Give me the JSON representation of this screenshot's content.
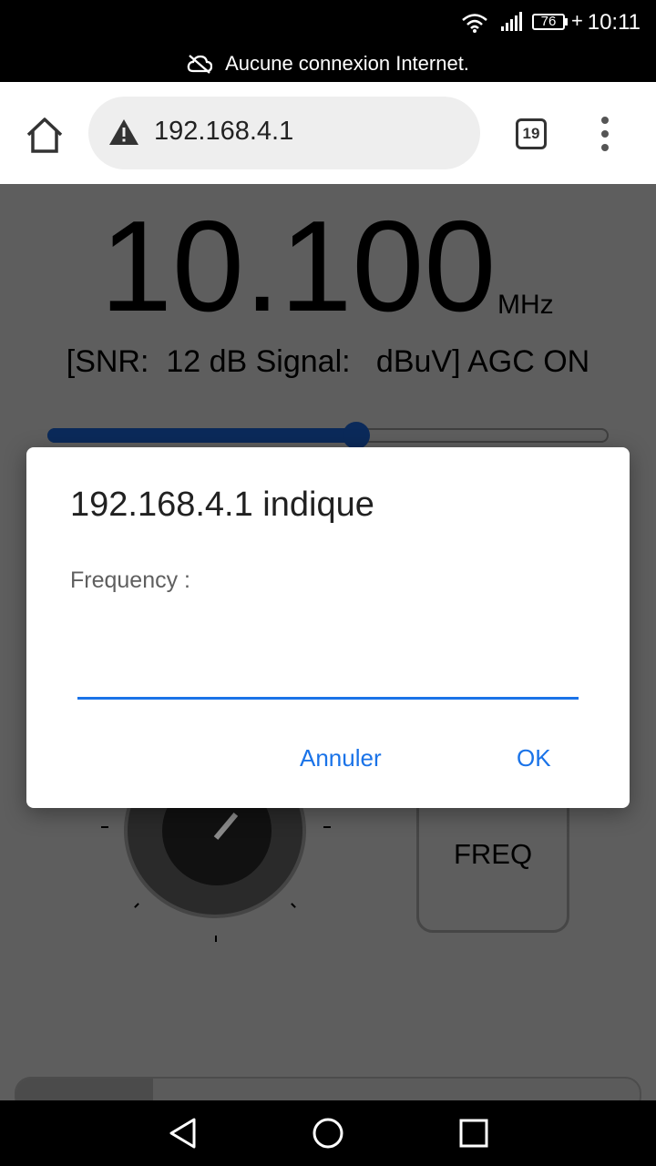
{
  "status_bar": {
    "time": "10:11",
    "battery_level": "76",
    "charging_symbol": "+",
    "offline_message": "Aucune connexion Internet.",
    "icons": [
      "wifi-icon",
      "signal-icon",
      "battery-icon",
      "cloud-off-icon"
    ]
  },
  "browser": {
    "url": "192.168.4.1",
    "tab_count": "19",
    "icons": [
      "home-icon",
      "warning-icon",
      "more-vert-icon"
    ]
  },
  "page": {
    "frequency": "10.100",
    "unit": "MHz",
    "signal_line": "[SNR:  12 dB Signal:   dBuV] AGC ON",
    "slider_fraction": 0.55,
    "freq_button_label": "FREQ",
    "accent_color": "#0b2a5a"
  },
  "dialog": {
    "title": "192.168.4.1 indique",
    "message": "Frequency :",
    "input_value": "",
    "cancel_label": "Annuler",
    "ok_label": "OK",
    "button_color": "#1a73e8"
  },
  "nav_bar": {
    "icons": [
      "back-icon",
      "home-circle-icon",
      "recents-icon"
    ]
  }
}
